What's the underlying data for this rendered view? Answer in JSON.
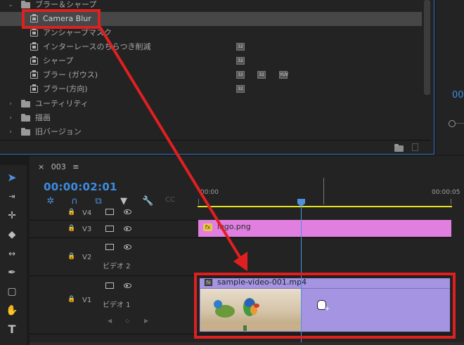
{
  "effects_panel": {
    "rows": [
      {
        "kind": "folder",
        "expanded": true,
        "label": "ブラー＆シャープ",
        "indent": 0
      },
      {
        "kind": "effect",
        "label": "Camera Blur",
        "selected": true,
        "badges": []
      },
      {
        "kind": "effect",
        "label": "アンシャープマスク",
        "badges": []
      },
      {
        "kind": "effect",
        "label": "インターレースのちらつき削減",
        "badges": [
          "32"
        ]
      },
      {
        "kind": "effect",
        "label": "シャープ",
        "badges": [
          "32"
        ]
      },
      {
        "kind": "effect",
        "label": "ブラー (ガウス)",
        "badges": [
          "32",
          "32",
          "YUV"
        ]
      },
      {
        "kind": "effect",
        "label": "ブラー(方向)",
        "badges": [
          "32"
        ]
      },
      {
        "kind": "folder",
        "expanded": false,
        "label": "ユーティリティ"
      },
      {
        "kind": "folder",
        "expanded": false,
        "label": "描画"
      },
      {
        "kind": "folder",
        "expanded": false,
        "label": "旧バージョン"
      }
    ],
    "footer_icons": [
      "new-bin-icon",
      "trash-icon"
    ]
  },
  "right_panel": {
    "timecode_partial": "00"
  },
  "timeline": {
    "tab_close": "×",
    "sequence_name": "003",
    "menu_icon": "≡",
    "timecode": "00:00:02:01",
    "ruler": {
      "start": "00:00",
      "end": "00:00:05"
    },
    "tracks": [
      {
        "id": "V4",
        "label": "V4",
        "name": ""
      },
      {
        "id": "V3",
        "label": "V3",
        "name": ""
      },
      {
        "id": "V2",
        "label": "V2",
        "name": "ビデオ 2"
      },
      {
        "id": "V1",
        "label": "V1",
        "name": "ビデオ 1"
      }
    ],
    "clips": {
      "logo": {
        "name": "logo.png",
        "fx": "fx"
      },
      "video": {
        "name": "sample-video-001.mp4",
        "fx": "fx"
      }
    }
  },
  "tools": [
    "selection-tool",
    "track-select-tool",
    "ripple-edit-tool",
    "razor-tool",
    "slip-tool",
    "pen-tool",
    "rectangle-tool",
    "hand-tool",
    "type-tool"
  ],
  "annotation": {
    "color": "#e02020"
  },
  "colors": {
    "accent": "#3d8de0",
    "logo_clip": "#e07fe0",
    "video_clip": "#a494e2",
    "work_area": "#e6e51f"
  }
}
